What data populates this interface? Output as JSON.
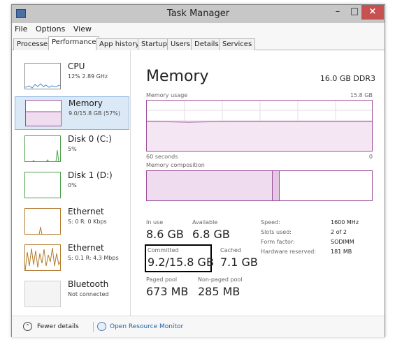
{
  "window": {
    "title": "Task Manager",
    "min_label": "–",
    "max_label": "□",
    "close_label": "×"
  },
  "menu": [
    "File",
    "Options",
    "View"
  ],
  "tabs": [
    "Processes",
    "Performance",
    "App history",
    "Startup",
    "Users",
    "Details",
    "Services"
  ],
  "active_tab": "Performance",
  "sidebar": [
    {
      "name": "CPU",
      "sub": "12% 2.89 GHz"
    },
    {
      "name": "Memory",
      "sub": "9.0/15.8 GB (57%)"
    },
    {
      "name": "Disk 0 (C:)",
      "sub": "5%"
    },
    {
      "name": "Disk 1 (D:)",
      "sub": "0%"
    },
    {
      "name": "Ethernet",
      "sub": "S: 0 R: 0 Kbps"
    },
    {
      "name": "Ethernet",
      "sub": "S: 0.1 R: 4.3 Mbps"
    },
    {
      "name": "Bluetooth",
      "sub": "Not connected"
    }
  ],
  "main": {
    "title": "Memory",
    "spec": "16.0 GB DDR3",
    "usage_label": "Memory usage",
    "usage_max": "15.8 GB",
    "seconds_label": "60 seconds",
    "zero_label": "0",
    "composition_label": "Memory composition",
    "stats": {
      "in_use_label": "In use",
      "in_use_value": "8.6 GB",
      "available_label": "Available",
      "available_value": "6.8 GB",
      "committed_label": "Committed",
      "committed_value": "9.2/15.8 GB",
      "cached_label": "Cached",
      "cached_value": "7.1 GB",
      "paged_label": "Paged pool",
      "paged_value": "673 MB",
      "nonpaged_label": "Non-paged pool",
      "nonpaged_value": "285 MB"
    },
    "specs": [
      {
        "label": "Speed:",
        "value": "1600 MHz"
      },
      {
        "label": "Slots used:",
        "value": "2 of 2"
      },
      {
        "label": "Form factor:",
        "value": "SODIMM"
      },
      {
        "label": "Hardware reserved:",
        "value": "181 MB"
      }
    ]
  },
  "footer": {
    "fewer_details_label": "Fewer details",
    "open_monitor_label": "Open Resource Monitor"
  },
  "colors": {
    "memory_accent": "#9b4f9b",
    "cpu_accent": "#4a8fd1",
    "disk_accent": "#4aa14a",
    "ethernet_accent": "#b37a2e",
    "link": "#1f5fa8"
  }
}
